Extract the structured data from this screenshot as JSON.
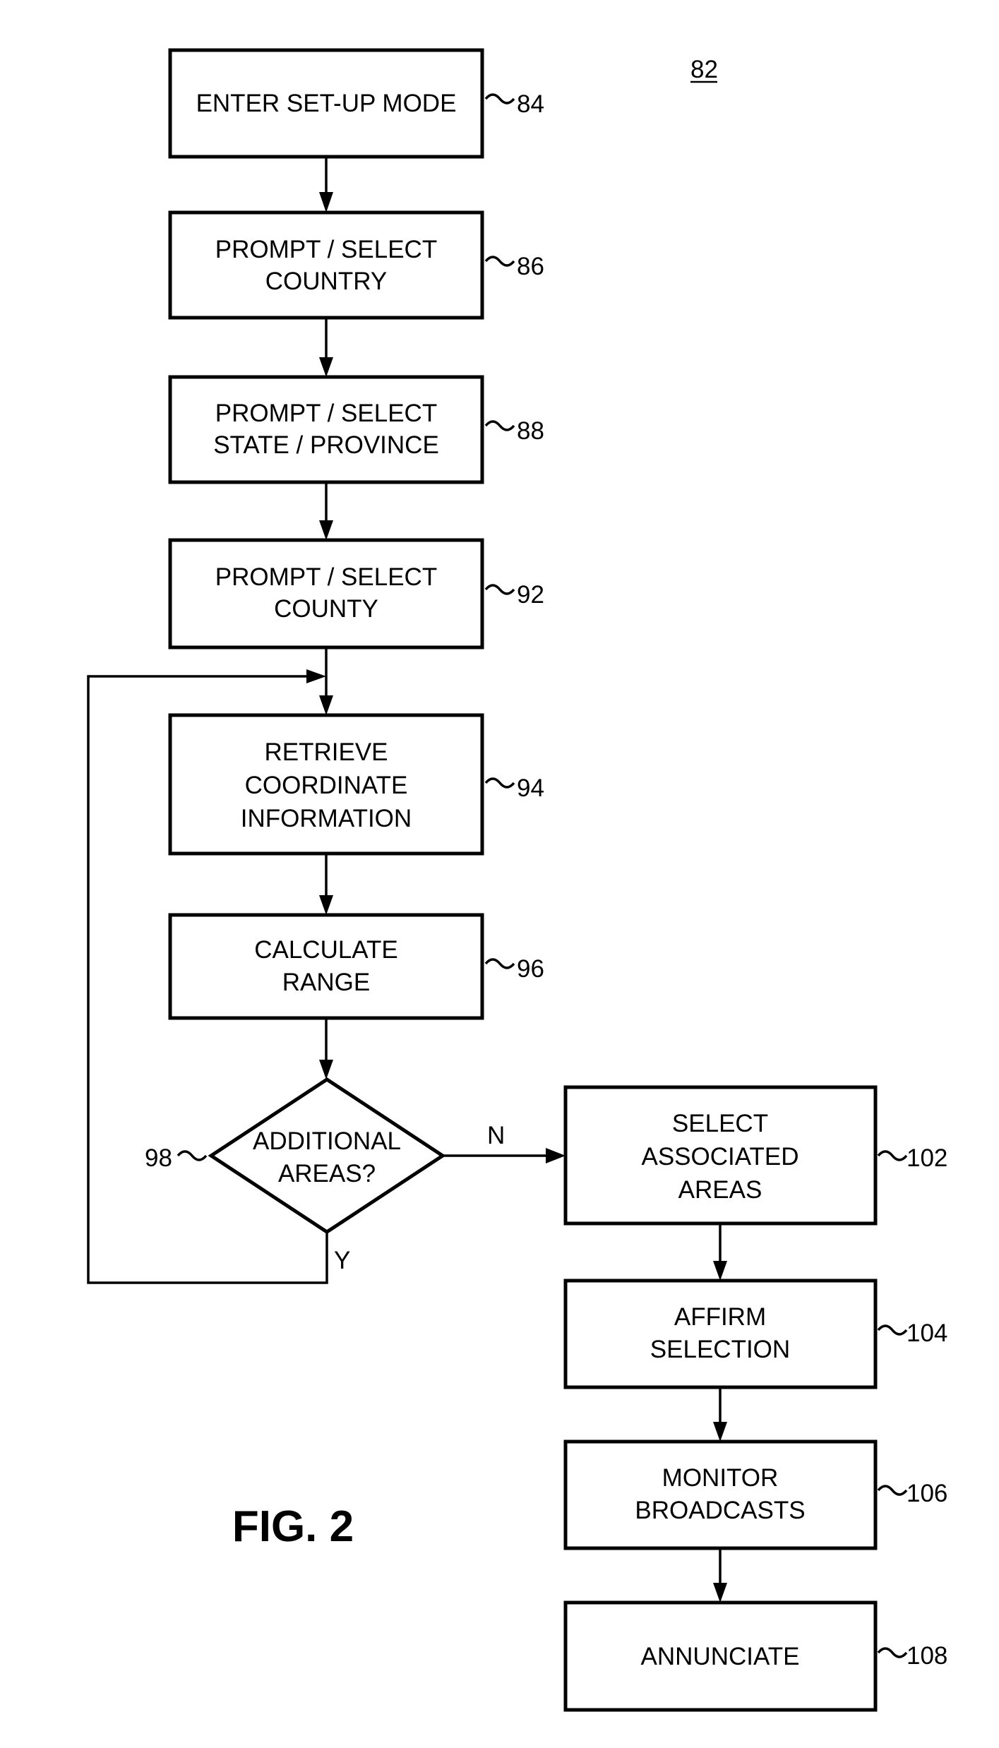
{
  "figure": {
    "label": "FIG. 2",
    "reference": "82"
  },
  "steps": [
    {
      "id": "84",
      "lines": [
        "ENTER SET-UP MODE"
      ]
    },
    {
      "id": "86",
      "lines": [
        "PROMPT / SELECT",
        "COUNTRY"
      ]
    },
    {
      "id": "88",
      "lines": [
        "PROMPT / SELECT",
        "STATE / PROVINCE"
      ]
    },
    {
      "id": "92",
      "lines": [
        "PROMPT / SELECT",
        "COUNTY"
      ]
    },
    {
      "id": "94",
      "lines": [
        "RETRIEVE",
        "COORDINATE",
        "INFORMATION"
      ]
    },
    {
      "id": "96",
      "lines": [
        "CALCULATE",
        "RANGE"
      ]
    },
    {
      "id": "102",
      "lines": [
        "SELECT",
        "ASSOCIATED",
        "AREAS"
      ]
    },
    {
      "id": "104",
      "lines": [
        "AFFIRM",
        "SELECTION"
      ]
    },
    {
      "id": "106",
      "lines": [
        "MONITOR",
        "BROADCASTS"
      ]
    },
    {
      "id": "108",
      "lines": [
        "ANNUNCIATE"
      ]
    }
  ],
  "decision": {
    "id": "98",
    "lines": [
      "ADDITIONAL",
      "AREAS?"
    ],
    "yes_label": "Y",
    "no_label": "N"
  }
}
